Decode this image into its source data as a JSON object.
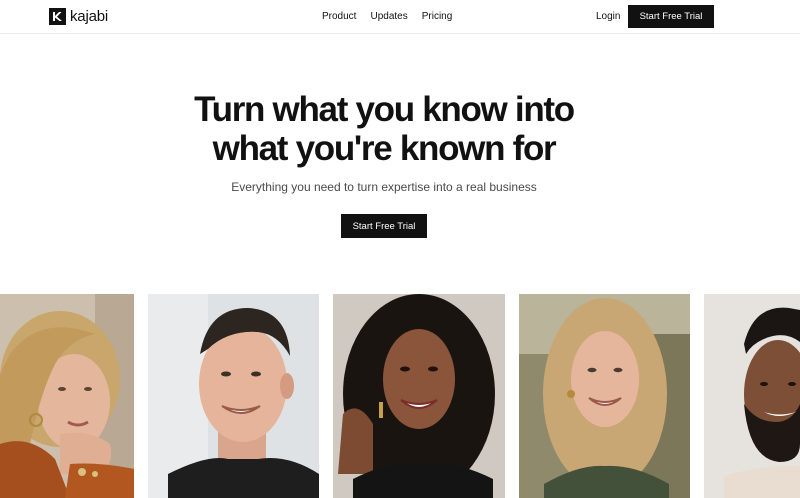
{
  "header": {
    "logo_text": "kajabi",
    "nav": [
      {
        "label": "Product"
      },
      {
        "label": "Updates"
      },
      {
        "label": "Pricing"
      }
    ],
    "login_label": "Login",
    "cta_label": "Start Free Trial"
  },
  "hero": {
    "title_line1": "Turn what you know into",
    "title_line2": "what you're known for",
    "subtitle": "Everything you need to turn expertise into a real business",
    "cta_label": "Start Free Trial"
  },
  "colors": {
    "accent": "#111111",
    "background": "#ffffff",
    "subtitle": "#4a4a4a"
  },
  "photos": [
    {
      "name": "creator-photo-1"
    },
    {
      "name": "creator-photo-2"
    },
    {
      "name": "creator-photo-3"
    },
    {
      "name": "creator-photo-4"
    },
    {
      "name": "creator-photo-5"
    }
  ]
}
